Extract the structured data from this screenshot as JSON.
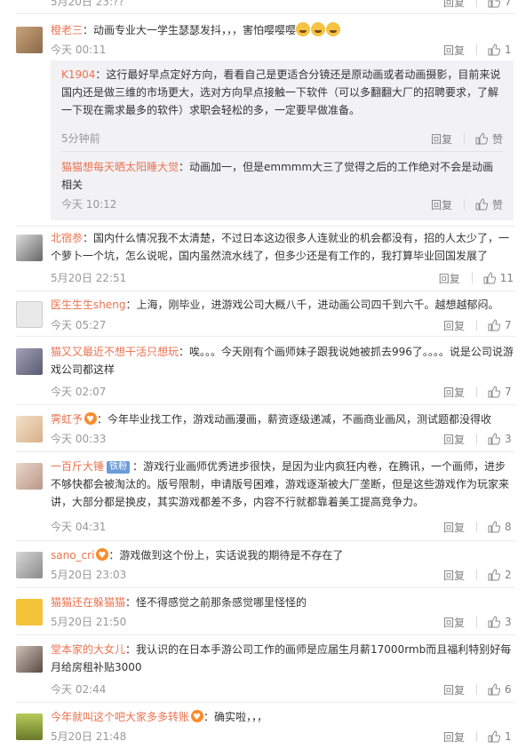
{
  "actions": {
    "reply": "回复",
    "like_placeholder": "赞"
  },
  "top_row": {
    "time": "5月20日 23:??",
    "likes": "7"
  },
  "c1": {
    "name": "橙老三",
    "text": "：动画专业大一学生瑟瑟发抖，，，害怕嘤嘤嘤",
    "time": "今天 00:11",
    "likes": "1",
    "replies": [
      {
        "name": "K1904",
        "text": "：这行最好早点定好方向，看看自己是更适合分镜还是原动画或者动画摄影，目前来说国内还是做三维的市场更大，选对方向早点接触一下软件（可以多翻翻大厂的招聘要求，了解一下现在需求最多的软件）求职会轻松的多，一定要早做准备。",
        "time": "5分钟前",
        "likes": "赞"
      },
      {
        "name": "猫猫想每天晒太阳睡大觉",
        "text": "：动画加一，但是emmmm大三了觉得之后的工作绝对不会是动画相关",
        "time": "今天 10:12",
        "likes": "赞"
      }
    ]
  },
  "c2": {
    "name": "北宿参",
    "text": "：国内什么情况我不太清楚，不过日本这边很多人连就业的机会都没有，招的人太少了，一个萝卜一个坑，怎么说呢，国内虽然流水线了，但多少还是有工作的，我打算毕业回国发展了",
    "time": "5月20日 22:51",
    "likes": "11"
  },
  "c3": {
    "name": "医生生生sheng",
    "text": "：上海，刚毕业，进游戏公司大概八千，进动画公司四千到六千。越想越郁闷。",
    "time": "今天 05:27",
    "likes": "7"
  },
  "c4": {
    "name": "猫又又最近不想干活只想玩",
    "text": "：唉。。。今天刚有个画师妹子跟我说她被抓去996了。。。。说是公司说游戏公司都这样",
    "time": "今天 02:07",
    "likes": "7"
  },
  "c5": {
    "name": "霁虹予",
    "text": "：今年毕业找工作，游戏动画漫画，薪资逐级递减，不画商业画风，测试题都没得收",
    "time": "今天 00:33",
    "likes": "3"
  },
  "c6": {
    "name": "一百斤大锤",
    "tag": "铁粉",
    "text": "：游戏行业画师优秀进步很快，是因为业内疯狂内卷，在腾讯，一个画师，进步不够快都会被淘汰的。版号限制，申请版号困难，游戏逐渐被大厂垄断，但是这些游戏作为玩家来讲，大部分都是换皮，其实游戏都差不多，内容不行就都靠着美工提高竞争力。",
    "time": "今天 04:31",
    "likes": "8"
  },
  "c7": {
    "name": "sano_cri",
    "text": "：游戏做到这个份上，实话说我的期待是不存在了",
    "time": "5月20日 23:03",
    "likes": "2"
  },
  "c8": {
    "name": "猫猫还在躲猫猫",
    "text": "：怪不得感觉之前那条感觉哪里怪怪的",
    "time": "5月20日 21:50",
    "likes": "3"
  },
  "c9": {
    "name": "堂本家的大女儿",
    "text": "：我认识的在日本手游公司工作的画师是应届生月薪17000rmb而且福利特别好每月给房租补贴3000",
    "time": "今天 02:44",
    "likes": "6"
  },
  "c10": {
    "name": "今年就叫这个吧大家多多转账",
    "text": "：确实啦，，，",
    "time": "5月20日 21:48",
    "likes": "1"
  },
  "colors": {
    "name_link": "#eb7350",
    "meta": "#999999",
    "reply_bg": "#f2f2f5"
  },
  "icons": {
    "like": "thumbs-up-icon"
  }
}
